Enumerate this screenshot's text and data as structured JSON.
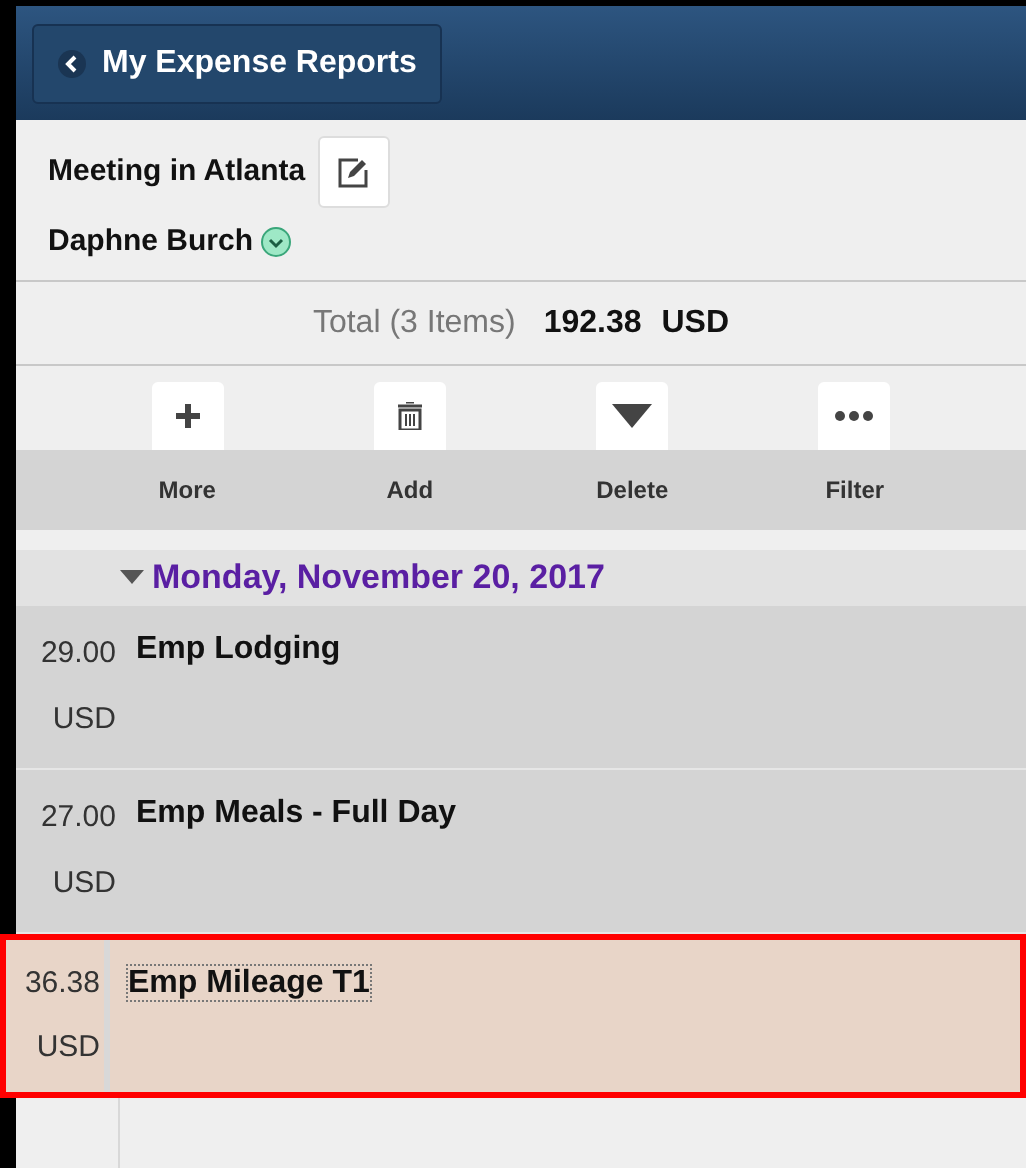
{
  "header": {
    "back_button": "My Expense Reports"
  },
  "report": {
    "title": "Meeting in Atlanta",
    "owner": "Daphne Burch"
  },
  "total": {
    "label": "Total (3 Items)",
    "amount": "192.38",
    "currency": "USD"
  },
  "toolbar": [
    {
      "kind": "add",
      "label": "More"
    },
    {
      "kind": "delete",
      "label": "Add"
    },
    {
      "kind": "filter",
      "label": "Delete"
    },
    {
      "kind": "more",
      "label": "Filter"
    }
  ],
  "date_group": {
    "label": "Monday, November 20, 2017",
    "expanded": true
  },
  "expenses": [
    {
      "type": "Emp Lodging",
      "amount": "29.00",
      "currency": "USD",
      "selected": false
    },
    {
      "type": "Emp Meals - Full Day",
      "amount": "27.00",
      "currency": "USD",
      "selected": false
    },
    {
      "type": "Emp Mileage T1",
      "amount": "36.38",
      "currency": "USD",
      "selected": true
    }
  ]
}
